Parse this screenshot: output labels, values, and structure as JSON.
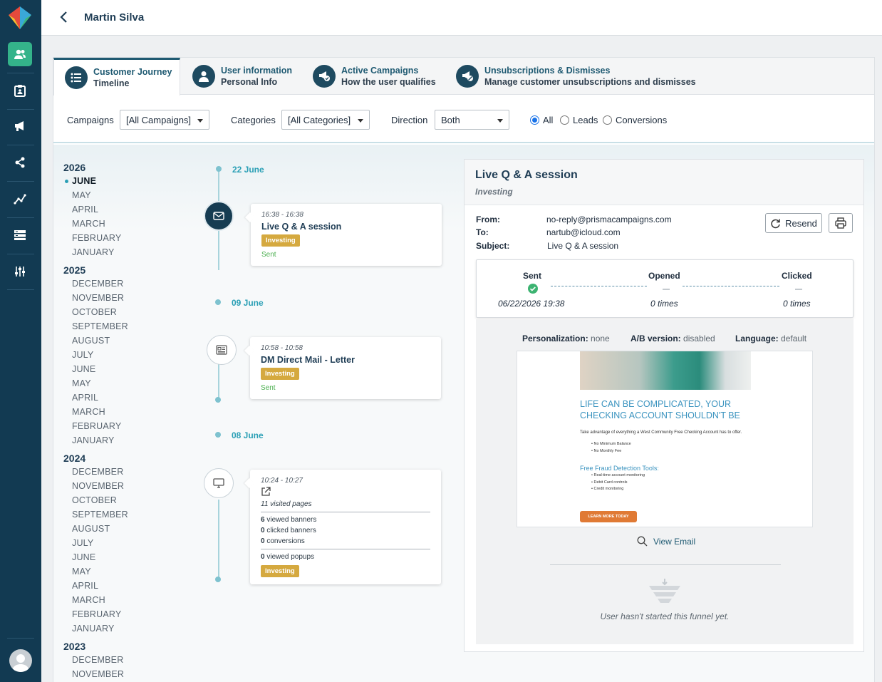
{
  "header": {
    "title": "Martin Silva"
  },
  "sidebar": {
    "items": [
      {
        "name": "contacts-icon",
        "active": true
      },
      {
        "name": "clipboard-icon"
      },
      {
        "name": "megaphone-icon"
      },
      {
        "name": "share-icon"
      },
      {
        "name": "analytics-icon"
      },
      {
        "name": "server-icon"
      },
      {
        "name": "sliders-icon"
      }
    ]
  },
  "tabs": [
    {
      "line1": "Customer Journey",
      "line2": "Timeline"
    },
    {
      "line1": "User information",
      "line2": "Personal Info"
    },
    {
      "line1": "Active Campaigns",
      "line2": "How the user qualifies"
    },
    {
      "line1": "Unsubscriptions & Dismisses",
      "line2": "Manage customer unsubscriptions and dismisses"
    }
  ],
  "filters": {
    "campaigns_label": "Campaigns",
    "campaigns_value": "[All Campaigns]",
    "categories_label": "Categories",
    "categories_value": "[All Categories]",
    "direction_label": "Direction",
    "direction_value": "Both",
    "radio_all": "All",
    "radio_leads": "Leads",
    "radio_conversions": "Conversions"
  },
  "years": [
    {
      "year": "2026",
      "months": [
        "JUNE",
        "MAY",
        "APRIL",
        "MARCH",
        "FEBRUARY",
        "JANUARY"
      ],
      "current": "JUNE"
    },
    {
      "year": "2025",
      "months": [
        "DECEMBER",
        "NOVEMBER",
        "OCTOBER",
        "SEPTEMBER",
        "AUGUST",
        "JULY",
        "JUNE",
        "MAY",
        "APRIL",
        "MARCH",
        "FEBRUARY",
        "JANUARY"
      ]
    },
    {
      "year": "2024",
      "months": [
        "DECEMBER",
        "NOVEMBER",
        "OCTOBER",
        "SEPTEMBER",
        "AUGUST",
        "JULY",
        "JUNE",
        "MAY",
        "APRIL",
        "MARCH",
        "FEBRUARY",
        "JANUARY"
      ]
    },
    {
      "year": "2023",
      "months": [
        "DECEMBER",
        "NOVEMBER"
      ]
    }
  ],
  "timeline": {
    "date1": "22 June",
    "card1": {
      "time": "16:38 - 16:38",
      "title": "Live Q & A session",
      "badge": "Investing",
      "status": "Sent"
    },
    "date2": "09 June",
    "card2": {
      "time": "10:58 - 10:58",
      "title": "DM Direct Mail - Letter",
      "badge": "Investing",
      "status": "Sent"
    },
    "date3": "08 June",
    "card3": {
      "time": "10:24 - 10:27",
      "visited": "11 visited pages",
      "stats": [
        {
          "n": "6",
          "label": "viewed banners"
        },
        {
          "n": "0",
          "label": "clicked banners"
        },
        {
          "n": "0",
          "label": "conversions"
        },
        {
          "n": "0",
          "label": "viewed popups"
        }
      ],
      "badge": "Investing"
    }
  },
  "detail": {
    "title": "Live Q & A session",
    "subtitle": "Investing",
    "from_label": "From:",
    "from": "no-reply@prismacampaigns.com",
    "to_label": "To:",
    "to": "nartub@icloud.com",
    "subject_label": "Subject:",
    "subject": "Live Q & A session",
    "resend": "Resend",
    "funnel": {
      "sent_label": "Sent",
      "sent_value": "06/22/2026 19:38",
      "opened_label": "Opened",
      "opened_value": "0 times",
      "clicked_label": "Clicked",
      "clicked_value": "0 times"
    },
    "personalization_label": "Personalization:",
    "personalization": "none",
    "ab_label": "A/B version:",
    "ab": "disabled",
    "language_label": "Language:",
    "language": "default",
    "email": {
      "headline1": "LIFE CAN BE COMPLICATED, YOUR",
      "headline2": "CHECKING ACCOUNT SHOULDN'T BE",
      "body": "Take advantage of everything a West Community Free Checking Account has to offer.",
      "list1": [
        "No Minimum Balance",
        "No Monthly Fee"
      ],
      "tools_title": "Free Fraud Detection Tools:",
      "list2": [
        "Real-time account monitoring",
        "Debit Card controls",
        "Credit monitoring"
      ],
      "cta": "LEARN MORE TODAY"
    },
    "view_email": "View Email",
    "no_funnel": "User hasn't started this funnel yet."
  },
  "colors": {
    "sidebar": "#123a52",
    "accent": "#34b38a",
    "badge": "#d5a93f",
    "link": "#2a9fb5"
  }
}
